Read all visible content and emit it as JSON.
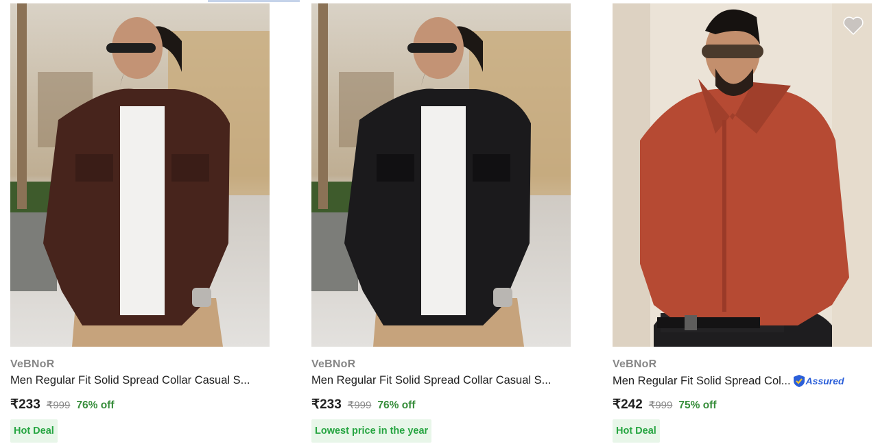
{
  "products": [
    {
      "brand": "VeBNoR",
      "title": "Men Regular Fit Solid Spread Collar Casual S...",
      "price": "₹233",
      "mrp": "₹999",
      "discount": "76% off",
      "badge": "Hot Deal",
      "shirt_color": "#47241c",
      "assured": false
    },
    {
      "brand": "VeBNoR",
      "title": "Men Regular Fit Solid Spread Collar Casual S...",
      "price": "₹233",
      "mrp": "₹999",
      "discount": "76% off",
      "badge": "Lowest price in the year",
      "shirt_color": "#1b1a1c",
      "assured": false
    },
    {
      "brand": "VeBNoR",
      "title": "Men Regular Fit Solid Spread Col...",
      "price": "₹242",
      "mrp": "₹999",
      "discount": "75% off",
      "badge": "Hot Deal",
      "shirt_color": "#b64a33",
      "assured": true,
      "assured_label": "Assured"
    }
  ],
  "icons": {
    "wishlist": "heart-icon",
    "assured": "shield-check-icon"
  },
  "colors": {
    "brand_text": "#878787",
    "discount": "#388e3c",
    "badge_bg": "#e8f6e9",
    "badge_text": "#26a541",
    "assured_blue": "#2b5fd9"
  }
}
